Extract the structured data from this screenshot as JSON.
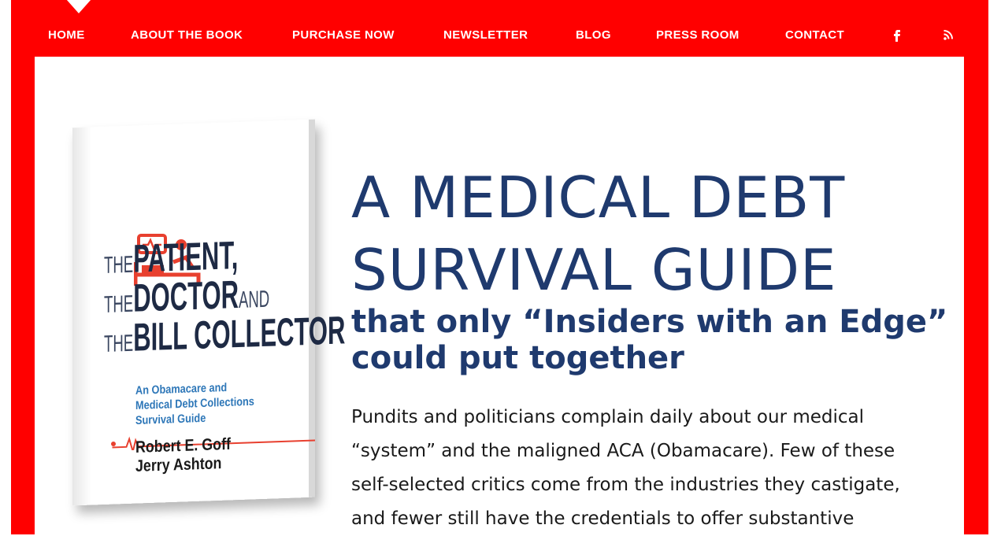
{
  "nav": {
    "items": [
      {
        "label": "HOME"
      },
      {
        "label": "ABOUT THE BOOK"
      },
      {
        "label": "PURCHASE NOW"
      },
      {
        "label": "NEWSLETTER"
      },
      {
        "label": "BLOG"
      },
      {
        "label": "PRESS ROOM"
      },
      {
        "label": "CONTACT"
      }
    ],
    "facebook_icon": "facebook-icon",
    "rss_icon": "rss-icon"
  },
  "book": {
    "title_lines": [
      {
        "prefix": "THE",
        "main": "PATIENT,",
        "suffix": ""
      },
      {
        "prefix": "THE",
        "main": "DOCTOR",
        "suffix": "AND"
      },
      {
        "prefix": "THE",
        "main": "BILL COLLECTOR",
        "suffix": ""
      }
    ],
    "subtitle_line1": "An Obamacare and",
    "subtitle_line2": "Medical Debt Collections",
    "subtitle_line3": "Survival Guide",
    "author1": "Robert E. Goff",
    "author2": "Jerry Ashton"
  },
  "hero": {
    "headline_line1": "A MEDICAL DEBT",
    "headline_line2": "SURVIVAL GUIDE",
    "subhead": "that only “Insiders with an Edge” could put together",
    "body": "Pundits and politicians complain daily about our medical “system” and the maligned ACA (Obamacare). Few of these self-selected critics come from the industries they castigate, and fewer still have the credentials to offer substantive"
  },
  "colors": {
    "frame": "#ff0000",
    "headline": "#1f3a6e",
    "book_accent": "#e8402f"
  }
}
